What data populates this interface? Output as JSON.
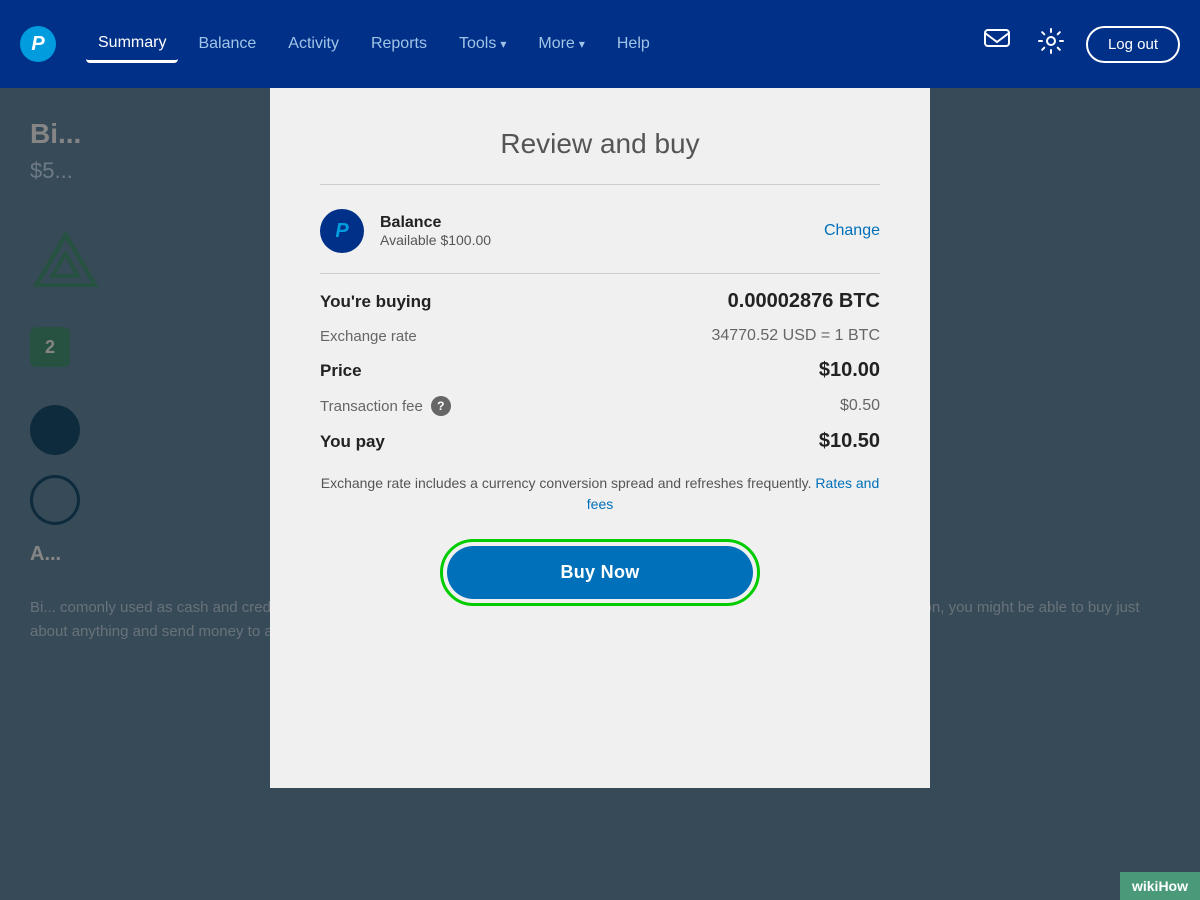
{
  "navbar": {
    "logo_letter": "P",
    "links": [
      {
        "label": "Summary",
        "active": true
      },
      {
        "label": "Balance",
        "active": false
      },
      {
        "label": "Activity",
        "active": false
      },
      {
        "label": "Reports",
        "active": false
      },
      {
        "label": "Tools",
        "active": false,
        "dropdown": true
      },
      {
        "label": "More",
        "active": false,
        "dropdown": true
      },
      {
        "label": "Help",
        "active": false
      }
    ],
    "logout_label": "Log out"
  },
  "background": {
    "title": "Bi...",
    "subtitle": "$5...",
    "badge_number": "2",
    "section_title": "A...",
    "body_text": "Bi... comonly used as cash and credit. It set off a revolution that has since inspired thousands of variations on the original. Someday soon, you might be able to buy just about anything and send money to anyone using bitcoins and other"
  },
  "modal": {
    "title": "Review and buy",
    "payment_method": {
      "name": "Balance",
      "available": "Available $100.00",
      "change_label": "Change"
    },
    "rows": [
      {
        "label": "You're buying",
        "label_bold": true,
        "value": "0.00002876 BTC",
        "value_bold": true
      },
      {
        "label": "Exchange rate",
        "label_bold": false,
        "value": "34770.52 USD = 1 BTC",
        "value_bold": false
      },
      {
        "label": "Price",
        "label_bold": true,
        "value": "$10.00",
        "value_bold": true
      },
      {
        "label": "Transaction fee",
        "label_bold": false,
        "has_info": true,
        "value": "$0.50",
        "value_muted": true
      },
      {
        "label": "You pay",
        "label_bold": true,
        "value": "$10.50",
        "value_bold": true
      }
    ],
    "disclaimer_text": "Exchange rate includes a currency conversion spread and refreshes frequently.",
    "rates_link_label": "Rates and fees",
    "buy_button_label": "Buy Now"
  },
  "wikihow": {
    "label": "wikiHow"
  }
}
